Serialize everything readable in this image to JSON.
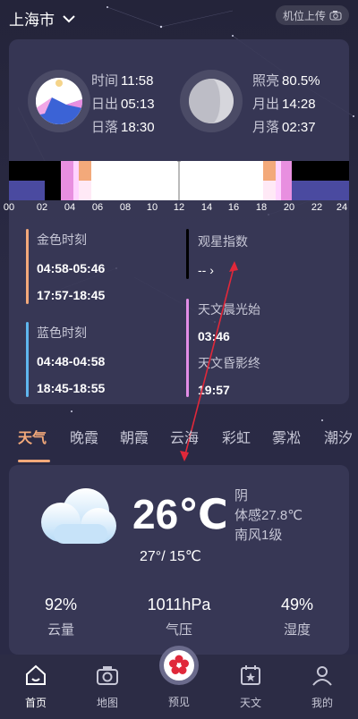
{
  "header": {
    "city": "上海市",
    "upload_label": "机位上传"
  },
  "sun": {
    "rows": [
      {
        "key": "时间",
        "value": "11:58"
      },
      {
        "key": "日出",
        "value": "05:13"
      },
      {
        "key": "日落",
        "value": "18:30"
      }
    ]
  },
  "moon": {
    "rows": [
      {
        "key": "照亮",
        "value": "80.5%"
      },
      {
        "key": "月出",
        "value": "14:28"
      },
      {
        "key": "月落",
        "value": "02:37"
      }
    ]
  },
  "timeline": {
    "hours": [
      "00",
      "02",
      "04",
      "06",
      "08",
      "10",
      "12",
      "14",
      "16",
      "18",
      "20",
      "22",
      "24"
    ]
  },
  "golden": {
    "title": "金色时刻",
    "morning": "04:58-05:46",
    "evening": "17:57-18:45"
  },
  "blue": {
    "title": "蓝色时刻",
    "morning": "04:48-04:58",
    "evening": "18:45-18:55"
  },
  "stargazing": {
    "title": "观星指数",
    "value": "-- ›"
  },
  "astro": {
    "dawn_title": "天文晨光始",
    "dawn_time": "03:46",
    "dusk_title": "天文昏影终",
    "dusk_time": "19:57"
  },
  "tabs": [
    "天气",
    "晚霞",
    "朝霞",
    "云海",
    "彩虹",
    "雾凇",
    "潮汐"
  ],
  "weather": {
    "temp": "26℃",
    "condition": "阴",
    "feels_like": "体感27.8℃",
    "wind": "南风1级",
    "range": "27°/  15℃",
    "stats": [
      {
        "value": "92%",
        "label": "云量"
      },
      {
        "value": "1011hPa",
        "label": "气压"
      },
      {
        "value": "49%",
        "label": "湿度"
      }
    ]
  },
  "nav": [
    {
      "label": "首页",
      "icon": "home-icon"
    },
    {
      "label": "地图",
      "icon": "camera-icon"
    },
    {
      "label": "预见",
      "icon": "flower-icon"
    },
    {
      "label": "天文",
      "icon": "calendar-star-icon"
    },
    {
      "label": "我的",
      "icon": "user-icon"
    }
  ],
  "colors": {
    "accent": "#f3a97a",
    "golden": "#f3a97a",
    "blue": "#5fb6ee",
    "astro": "#e28de6"
  }
}
